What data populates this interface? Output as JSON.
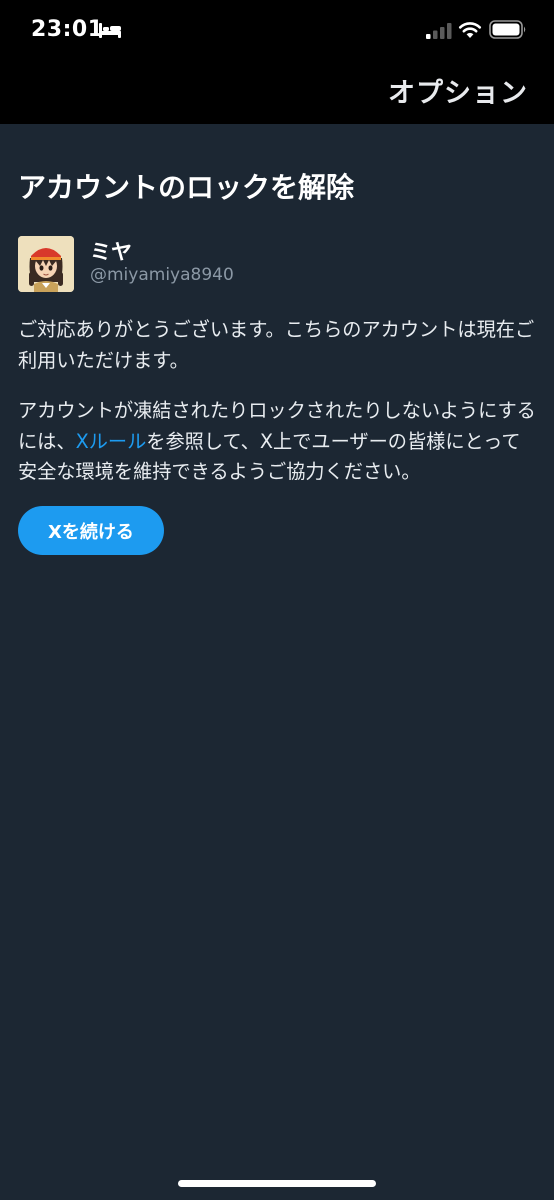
{
  "status_bar": {
    "time": "23:01",
    "icons": [
      "bed-icon",
      "cellular-signal-icon",
      "wifi-icon",
      "battery-icon"
    ]
  },
  "header": {
    "options_label": "オプション"
  },
  "main": {
    "title": "アカウントのロックを解除",
    "user": {
      "display_name": "ミヤ",
      "handle": "@miyamiya8940"
    },
    "paragraph1": "ご対応ありがとうございます。こちらのアカウントは現在ご利用いただけます。",
    "paragraph2": {
      "before_link": "アカウントが凍結されたりロックされたりしないようにするには、",
      "link_text": "Xルール",
      "after_link": "を参照して、X上でユーザーの皆様にとって安全な環境を維持できるようご協力ください。"
    },
    "continue_button": "Xを続ける"
  },
  "colors": {
    "background": "#1c2733",
    "header_background": "#000000",
    "accent": "#1d9bf0",
    "secondary_text": "#8b98a5"
  }
}
